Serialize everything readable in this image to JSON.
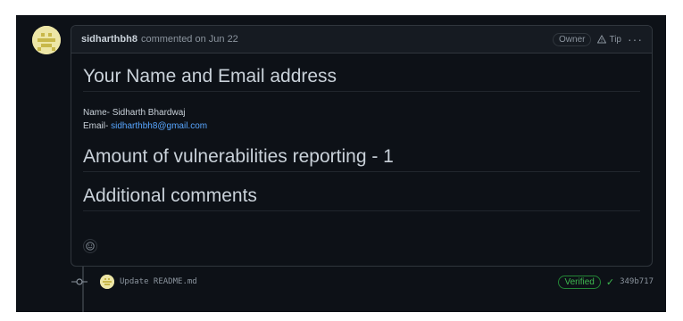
{
  "comment": {
    "author": "sidharthbh8",
    "meta": "commented on Jun 22",
    "owner_badge": "Owner",
    "tip_label": "Tip",
    "more_label": "···"
  },
  "body": {
    "heading_1": "Your Name and Email address",
    "name_line": "Name- Sidharth Bhardwaj",
    "email_prefix": "Email- ",
    "email_link": "sidharthbh8@gmail.com",
    "heading_2": "Amount of vulnerabilities reporting - 1",
    "heading_3": "Additional comments"
  },
  "commit": {
    "message": "Update README.md",
    "verified": "Verified",
    "sha": "349b717"
  },
  "icons": {
    "avatar": "identicon-avatar",
    "reaction": "smiley-icon",
    "tip": "alert-triangle-icon",
    "commit": "git-commit-icon",
    "check": "check-icon"
  },
  "colors": {
    "background": "#0d1117",
    "header_bg": "#161b22",
    "border": "#30363d",
    "text": "#c9d1d9",
    "muted": "#8b949e",
    "link": "#58a6ff",
    "verified": "#3fb950"
  }
}
